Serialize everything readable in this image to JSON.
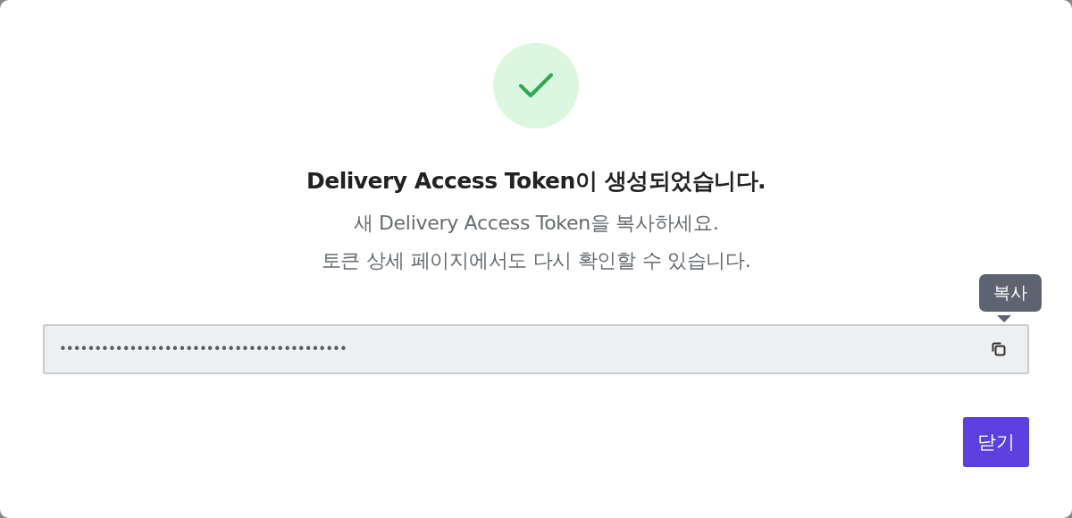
{
  "dialog": {
    "title": "Delivery Access Token이 생성되었습니다.",
    "messages": [
      "새 Delivery Access Token을 복사하세요.",
      "토큰 상세 페이지에서도 다시 확인할 수 있습니다."
    ],
    "token_field": {
      "value": "•••••••••••••••••••••••••••••••••••••••••"
    },
    "copy_tooltip": "복사",
    "buttons": [
      {
        "label": "닫기",
        "kind": "primary"
      }
    ]
  }
}
